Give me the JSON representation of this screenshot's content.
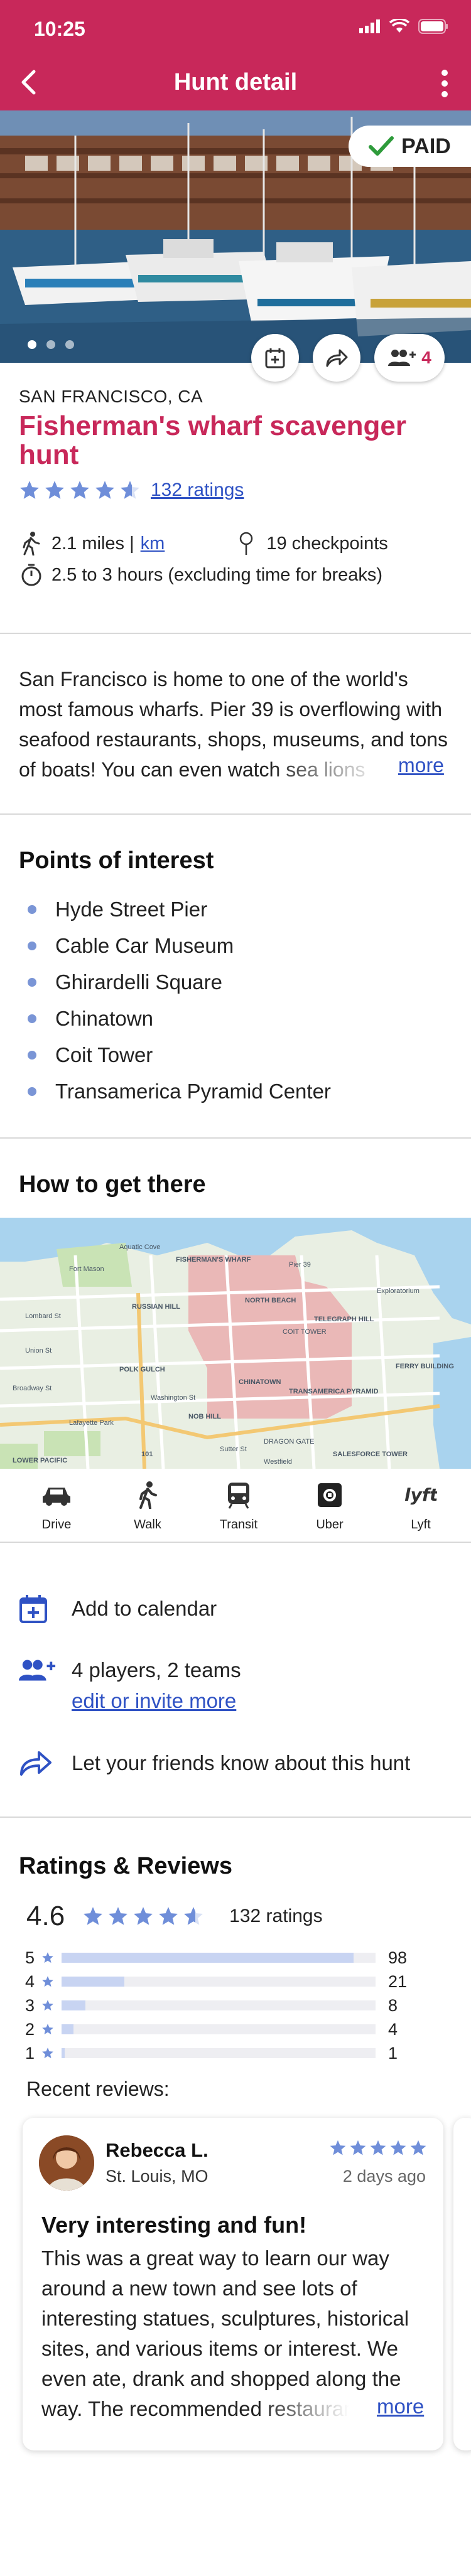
{
  "status_bar": {
    "time": "10:25"
  },
  "nav": {
    "title": "Hunt detail"
  },
  "hero": {
    "paid_label": "PAID",
    "slide_count": 3,
    "active_slide": 1
  },
  "float_actions": {
    "players_count": "4"
  },
  "hunt": {
    "location": "SAN FRANCISCO, CA",
    "title": "Fisherman's wharf scavenger hunt",
    "rating": 4.6,
    "ratings_link": "132 ratings",
    "distance": "2.1 miles |",
    "distance_unit_link": "km",
    "checkpoints": "19 checkpoints",
    "duration": "2.5 to 3 hours (excluding time for breaks)",
    "description": "San Francisco is home to one of the world's most famous wharfs. Pier 39 is overflowing with seafood restaurants, shops, museums, and tons of boats! You can even watch sea lions",
    "more_link": "more"
  },
  "points_of_interest": {
    "heading": "Points of interest",
    "items": [
      "Hyde Street Pier",
      "Cable Car Museum",
      "Ghirardelli Square",
      "Chinatown",
      "Coit Tower",
      "Transamerica Pyramid Center"
    ]
  },
  "directions": {
    "heading": "How to get there",
    "map_labels": [
      "Aquatic Cove",
      "FISHERMAN'S WHARF",
      "Pier 39",
      "Fort Mason",
      "RUSSIAN HILL",
      "NORTH BEACH",
      "TELEGRAPH HILL",
      "COIT TOWER",
      "Exploratorium",
      "Lombard St",
      "Union St",
      "POLK GULCH",
      "Broadway St",
      "CHINATOWN",
      "Washington St",
      "NOB HILL",
      "TRANSAMERICA PYRAMID",
      "Sutter St",
      "Westfield",
      "SALESFORCE TOWER",
      "Lafayette Park",
      "LOWER PACIFIC",
      "FERRY BUILDING",
      "DRAGON GATE",
      "101"
    ],
    "modes": [
      {
        "label": "Drive",
        "icon": "car-icon"
      },
      {
        "label": "Walk",
        "icon": "walk-icon"
      },
      {
        "label": "Transit",
        "icon": "transit-icon"
      },
      {
        "label": "Uber",
        "icon": "uber-icon"
      },
      {
        "label": "Lyft",
        "icon": "lyft-icon"
      }
    ]
  },
  "quick_actions": {
    "calendar": "Add to calendar",
    "players": "4 players, 2 teams",
    "players_link": "edit or invite more",
    "share": "Let your friends know about this hunt"
  },
  "ratings": {
    "heading": "Ratings & Reviews",
    "average": "4.6",
    "average_value": 4.6,
    "count_label": "132 ratings",
    "breakdown": [
      {
        "stars": "5",
        "count": "98",
        "value": 98
      },
      {
        "stars": "4",
        "count": "21",
        "value": 21
      },
      {
        "stars": "3",
        "count": "8",
        "value": 8
      },
      {
        "stars": "2",
        "count": "4",
        "value": 4
      },
      {
        "stars": "1",
        "count": "1",
        "value": 1
      }
    ],
    "max_value": 98,
    "recent_heading": "Recent reviews:",
    "review": {
      "name": "Rebecca L.",
      "location": "St. Louis, MO",
      "stars": 5,
      "date": "2 days ago",
      "title": "Very interesting and fun!",
      "body": "This was a great way to learn our way around a new town and see lots of interesting statues, sculptures, historical sites, and various items or interest. We even ate, drank and shopped along the way. The recommended restaurants",
      "more_link": "more"
    }
  },
  "colors": {
    "brand": "#c8285a",
    "link": "#2f52c4",
    "star": "#6f8ed9",
    "bar": "#c8d4f2",
    "map_area": "#e9a6a8"
  }
}
